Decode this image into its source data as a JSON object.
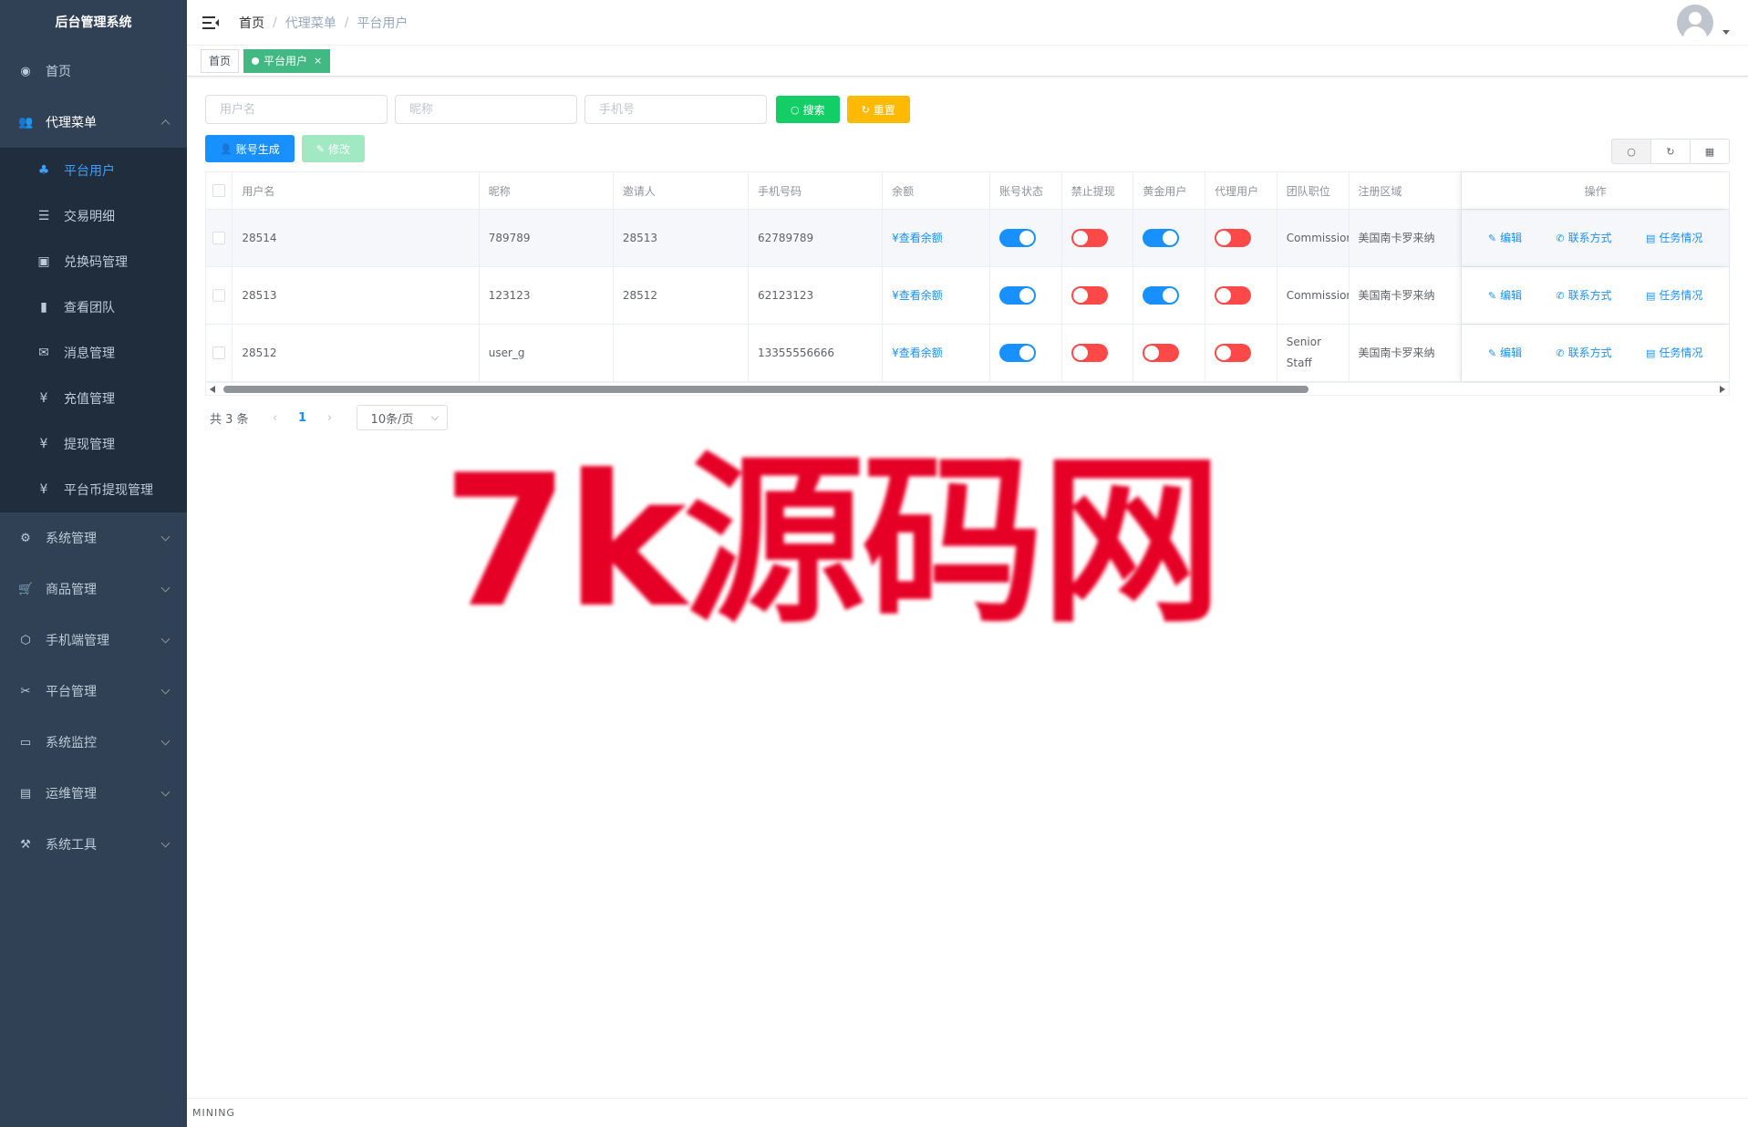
{
  "app": {
    "title": "后台管理系统"
  },
  "sidebar": {
    "items": [
      {
        "label": "首页",
        "icon": "dashboard-icon",
        "glyph": "◉"
      },
      {
        "label": "代理菜单",
        "icon": "user-group-icon",
        "glyph": "👥",
        "open": true,
        "children": [
          {
            "label": "平台用户",
            "icon": "tree-icon",
            "glyph": "♣",
            "active": true
          },
          {
            "label": "交易明细",
            "icon": "list-icon",
            "glyph": "☰"
          },
          {
            "label": "兑换码管理",
            "icon": "code-icon",
            "glyph": "▣"
          },
          {
            "label": "查看团队",
            "icon": "bar-chart-icon",
            "glyph": "▮"
          },
          {
            "label": "消息管理",
            "icon": "message-icon",
            "glyph": "✉"
          },
          {
            "label": "充值管理",
            "icon": "yen-icon",
            "glyph": "¥"
          },
          {
            "label": "提现管理",
            "icon": "yen-icon",
            "glyph": "¥"
          },
          {
            "label": "平台币提现管理",
            "icon": "yen-icon",
            "glyph": "¥"
          }
        ]
      },
      {
        "label": "系统管理",
        "icon": "gear-icon",
        "glyph": "⚙"
      },
      {
        "label": "商品管理",
        "icon": "cart-icon",
        "glyph": "🛒"
      },
      {
        "label": "手机端管理",
        "icon": "cube-icon",
        "glyph": "⬡"
      },
      {
        "label": "平台管理",
        "icon": "tools-icon",
        "glyph": "✂"
      },
      {
        "label": "系统监控",
        "icon": "monitor-icon",
        "glyph": "▭"
      },
      {
        "label": "运维管理",
        "icon": "server-icon",
        "glyph": "▤"
      },
      {
        "label": "系统工具",
        "icon": "wrench-icon",
        "glyph": "⚒"
      }
    ]
  },
  "navbar": {
    "breadcrumb": [
      "首页",
      "代理菜单",
      "平台用户"
    ]
  },
  "tags": [
    {
      "label": "首页",
      "active": false
    },
    {
      "label": "平台用户",
      "active": true,
      "close": "×"
    }
  ],
  "search": {
    "username_placeholder": "用户名",
    "nickname_placeholder": "昵称",
    "phone_placeholder": "手机号",
    "search_label": "搜索",
    "reset_label": "重置"
  },
  "toolbar": {
    "generate_label": "账号生成",
    "edit_label": "修改"
  },
  "table": {
    "columns": [
      "用户名",
      "昵称",
      "邀请人",
      "手机号码",
      "余额",
      "账号状态",
      "禁止提现",
      "黄金用户",
      "代理用户",
      "团队职位",
      "注册区域",
      "操作"
    ],
    "balance_link": "¥查看余额",
    "op_edit": "编辑",
    "op_contact": "联系方式",
    "op_task": "任务情况",
    "rows": [
      {
        "username": "28514",
        "nickname": "789789",
        "inviter": "28513",
        "phone": "62789789",
        "status": true,
        "no_withdraw": false,
        "gold": true,
        "agent": false,
        "position": "Commissioner",
        "region": "美国南卡罗来纳"
      },
      {
        "username": "28513",
        "nickname": "123123",
        "inviter": "28512",
        "phone": "62123123",
        "status": true,
        "no_withdraw": false,
        "gold": true,
        "agent": false,
        "position": "Commissioner",
        "region": "美国南卡罗来纳"
      },
      {
        "username": "28512",
        "nickname": "user_g",
        "inviter": "",
        "phone": "13355556666",
        "status": true,
        "no_withdraw": false,
        "gold": false,
        "agent": false,
        "position": "Senior Staff",
        "region": "美国南卡罗来纳"
      }
    ]
  },
  "pagination": {
    "total": "共 3 条",
    "current": "1",
    "size": "10条/页"
  },
  "watermark": "7k源码网",
  "footer": "MINING",
  "colors": {
    "sidebar_bg": "#304156",
    "primary": "#1890ff",
    "success": "#13ce66",
    "warning": "#ffba00",
    "danger": "#ff4949"
  }
}
